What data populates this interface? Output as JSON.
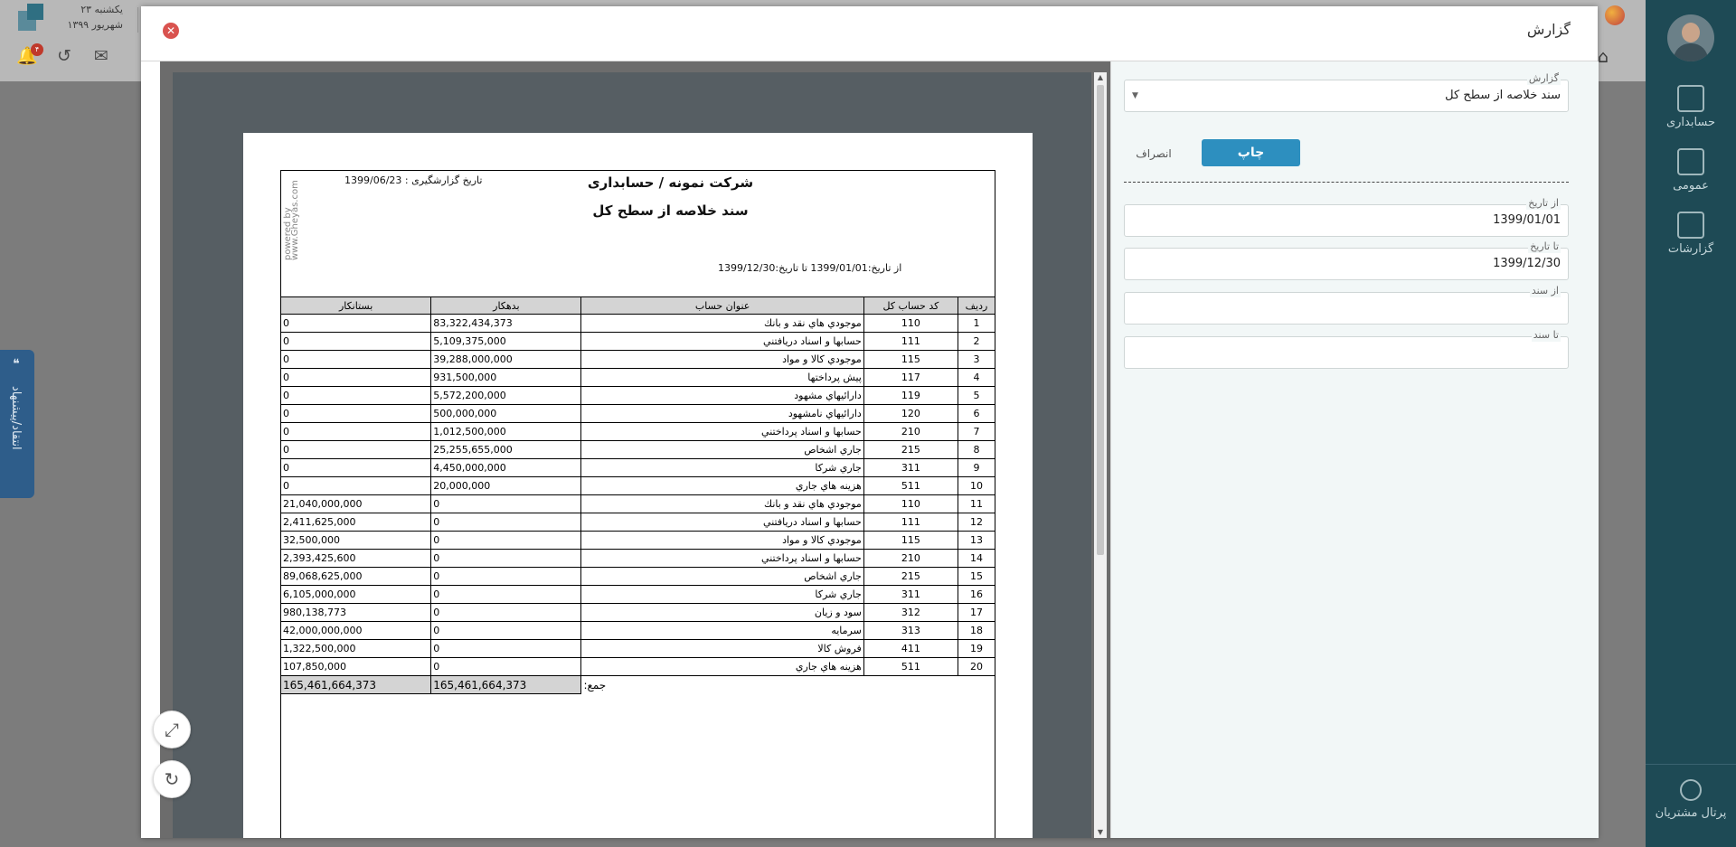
{
  "background": {
    "date_line1": "یکشنبه ۲۳",
    "date_line2": "شهریور ۱۳۹۹",
    "notification_count": "۴"
  },
  "sidebar": {
    "items": [
      {
        "label": "حسابداری",
        "icon": "accounting-icon"
      },
      {
        "label": "عمومی",
        "icon": "general-icon"
      },
      {
        "label": "گزارشات",
        "icon": "reports-icon"
      }
    ],
    "portal_label": "پرتال مشتریان"
  },
  "feedback": {
    "label": "انتقاد/پیشنهاد"
  },
  "modal": {
    "title": "گزارش"
  },
  "form": {
    "report_label": "گزارش",
    "report_value": "سند خلاصه از سطح کل",
    "print_label": "چاپ",
    "cancel_label": "انصراف",
    "from_date_label": "از تاریخ",
    "from_date_value": "1399/01/01",
    "to_date_label": "تا تاریخ",
    "to_date_value": "1399/12/30",
    "from_doc_label": "از سند",
    "from_doc_value": "",
    "to_doc_label": "تا سند",
    "to_doc_value": ""
  },
  "report": {
    "powered_by": "powered by www.Gheyas.com",
    "company": "شرکت نمونه / حسابداری",
    "title": "سند خلاصه از سطح کل",
    "report_date": "تاریخ گزارشگیری : 1399/06/23",
    "range": "از تاریخ:1399/01/01   تا تاریخ:1399/12/30",
    "headers": [
      "ردیف",
      "کد حساب کل",
      "عنوان حساب",
      "بدهکار",
      "بستانکار"
    ],
    "rows": [
      [
        "1",
        "110",
        "موجودي هاي نقد و بانك",
        "83,322,434,373",
        "0"
      ],
      [
        "2",
        "111",
        "حسابها و اسناد دريافتني",
        "5,109,375,000",
        "0"
      ],
      [
        "3",
        "115",
        "موجودي كالا و مواد",
        "39,288,000,000",
        "0"
      ],
      [
        "4",
        "117",
        "پيش پرداختها",
        "931,500,000",
        "0"
      ],
      [
        "5",
        "119",
        "دارائيهاي مشهود",
        "5,572,200,000",
        "0"
      ],
      [
        "6",
        "120",
        "دارائيهاي نامشهود",
        "500,000,000",
        "0"
      ],
      [
        "7",
        "210",
        "حسابها و اسناد پرداختني",
        "1,012,500,000",
        "0"
      ],
      [
        "8",
        "215",
        "جاري اشخاص",
        "25,255,655,000",
        "0"
      ],
      [
        "9",
        "311",
        "جاري شركا",
        "4,450,000,000",
        "0"
      ],
      [
        "10",
        "511",
        "هزينه هاي جاري",
        "20,000,000",
        "0"
      ],
      [
        "11",
        "110",
        "موجودي هاي نقد و بانك",
        "0",
        "21,040,000,000"
      ],
      [
        "12",
        "111",
        "حسابها و اسناد دريافتني",
        "0",
        "2,411,625,000"
      ],
      [
        "13",
        "115",
        "موجودي كالا و مواد",
        "0",
        "32,500,000"
      ],
      [
        "14",
        "210",
        "حسابها و اسناد پرداختني",
        "0",
        "2,393,425,600"
      ],
      [
        "15",
        "215",
        "جاري اشخاص",
        "0",
        "89,068,625,000"
      ],
      [
        "16",
        "311",
        "جاري شركا",
        "0",
        "6,105,000,000"
      ],
      [
        "17",
        "312",
        "سود و زيان",
        "0",
        "980,138,773"
      ],
      [
        "18",
        "313",
        "سرمايه",
        "0",
        "42,000,000,000"
      ],
      [
        "19",
        "411",
        "فروش كالا",
        "0",
        "1,322,500,000"
      ],
      [
        "20",
        "511",
        "هزينه هاي جاري",
        "0",
        "107,850,000"
      ]
    ],
    "total_label": "جمع:",
    "total_debit": "165,461,664,373",
    "total_credit": "165,461,664,373"
  }
}
